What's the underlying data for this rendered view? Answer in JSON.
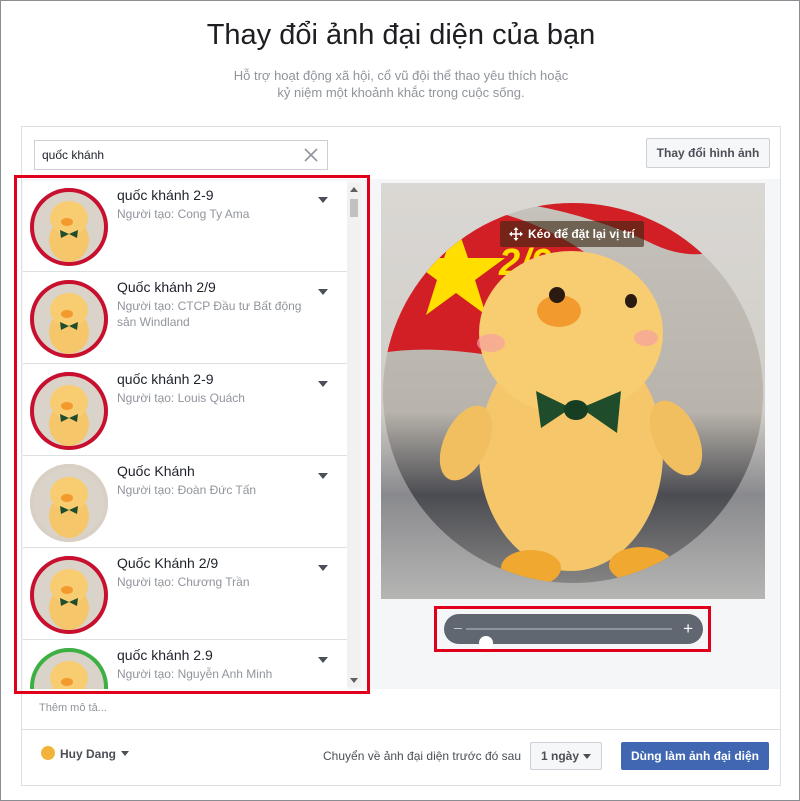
{
  "header": {
    "title": "Thay đổi ảnh đại diện của bạn",
    "subtitle_line1": "Hỗ trợ hoạt động xã hội, cổ vũ đội thể thao yêu thích hoặc",
    "subtitle_line2": "kỷ niệm một khoảnh khắc trong cuộc sống."
  },
  "search": {
    "value": "quốc khánh",
    "clear_icon": "close-icon"
  },
  "toolbar": {
    "change_image_label": "Thay đổi hình ảnh"
  },
  "frames": {
    "items": [
      {
        "title": "quốc khánh 2-9",
        "creator": "Người tạo: Cong Ty Ama",
        "ring": "#c8102e"
      },
      {
        "title": "Quốc khánh 2/9",
        "creator": "Người tạo: CTCP Đầu tư Bất động sản Windland",
        "ring": "#c8102e"
      },
      {
        "title": "quốc khánh 2-9",
        "creator": "Người tạo: Louis Quách",
        "ring": "#c8102e"
      },
      {
        "title": "Quốc Khánh",
        "creator": "Người tạo: Đoàn Đức Tấn",
        "ring": "#d8d0c4"
      },
      {
        "title": "Quốc Khánh 2/9",
        "creator": "Người tạo: Chương Trần",
        "ring": "#c8102e"
      },
      {
        "title": "quốc khánh 2.9",
        "creator": "Người tạo: Nguyễn Anh Minh",
        "ring": "#3cb043"
      }
    ]
  },
  "preview": {
    "reposition_label": "Kéo để đặt lại vị trí",
    "reposition_icon": "move-icon",
    "flag_text": "2/9",
    "flag_text_small": "2/9"
  },
  "zoom": {
    "level": 0.05,
    "minus_icon": "minus-icon",
    "plus_label": "+"
  },
  "footer": {
    "description_placeholder": "Thêm mô tả...",
    "user_name": "Huy Dang",
    "revert_label": "Chuyển về ảnh đại diện trước đó sau",
    "duration_value": "1 ngày",
    "submit_label": "Dùng làm ảnh đại diện"
  },
  "colors": {
    "primary": "#4267b2",
    "highlight": "#e0001b",
    "flag_red": "#d21f26",
    "flag_yellow": "#ffde00"
  }
}
